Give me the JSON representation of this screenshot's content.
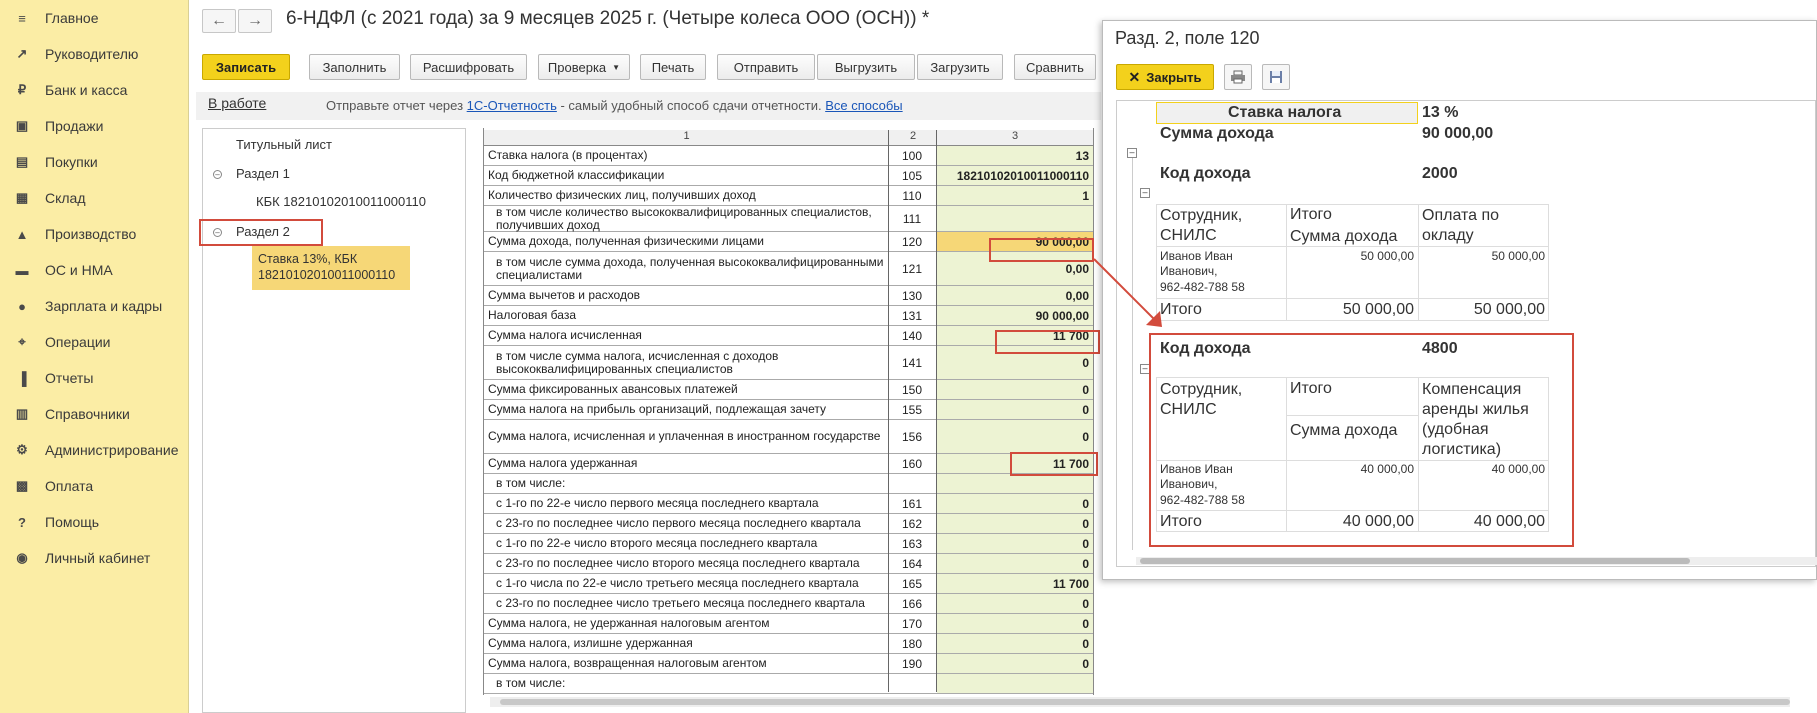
{
  "sidebar": {
    "items": [
      {
        "label": "Главное",
        "icon": "menu-icon"
      },
      {
        "label": "Руководителю",
        "icon": "chart-line-icon"
      },
      {
        "label": "Банк и касса",
        "icon": "coin-icon"
      },
      {
        "label": "Продажи",
        "icon": "bag-icon"
      },
      {
        "label": "Покупки",
        "icon": "cart-icon"
      },
      {
        "label": "Склад",
        "icon": "warehouse-icon"
      },
      {
        "label": "Производство",
        "icon": "factory-icon"
      },
      {
        "label": "ОС и НМА",
        "icon": "truck-icon"
      },
      {
        "label": "Зарплата и кадры",
        "icon": "person-icon"
      },
      {
        "label": "Операции",
        "icon": "operations-icon"
      },
      {
        "label": "Отчеты",
        "icon": "bar-chart-icon"
      },
      {
        "label": "Справочники",
        "icon": "book-icon"
      },
      {
        "label": "Администрирование",
        "icon": "gear-icon"
      },
      {
        "label": "Оплата",
        "icon": "payment-icon"
      },
      {
        "label": "Помощь",
        "icon": "question-icon"
      },
      {
        "label": "Личный кабинет",
        "icon": "account-icon"
      }
    ]
  },
  "header": {
    "title": "6-НДФЛ (с 2021 года) за 9 месяцев 2025 г. (Четыре колеса ООО (ОСН)) *",
    "back_icon": "arrow-left-icon",
    "forward_icon": "arrow-right-icon"
  },
  "toolbar": {
    "save": "Записать",
    "fill": "Заполнить",
    "decode": "Расшифровать",
    "check": "Проверка",
    "print": "Печать",
    "send": "Отправить",
    "upload": "Выгрузить",
    "download": "Загрузить",
    "compare": "Сравнить"
  },
  "infobar": {
    "status": "В работе",
    "text_before": "Отправьте отчет через ",
    "link1": "1С-Отчетность",
    "text_middle": " - самый удобный способ сдачи отчетности. ",
    "link2": "Все способы"
  },
  "tree": {
    "title_sheet": "Титульный лист",
    "section1": "Раздел 1",
    "kbk": "КБК 18210102010011000110",
    "section2": "Раздел 2",
    "selected_line1": "Ставка 13%, КБК",
    "selected_line2": "18210102010011000110"
  },
  "table": {
    "headers": [
      "1",
      "2",
      "3"
    ],
    "rows": [
      {
        "label": "Ставка налога (в процентах)",
        "code": "100",
        "value": "13"
      },
      {
        "label": "Код бюджетной классификации",
        "code": "105",
        "value": "18210102010011000110"
      },
      {
        "label": "Количество физических лиц, получивших доход",
        "code": "110",
        "value": "1"
      },
      {
        "label": "в том числе количество высококвалифицированных специалистов, получивших доход",
        "code": "111",
        "value": ""
      },
      {
        "label": "Сумма дохода, полученная физическими лицами",
        "code": "120",
        "value": "90 000,00"
      },
      {
        "label": "в том числе сумма дохода, полученная высококвалифицированными специалистами",
        "code": "121",
        "value": "0,00"
      },
      {
        "label": "Сумма вычетов и расходов",
        "code": "130",
        "value": "0,00"
      },
      {
        "label": "Налоговая база",
        "code": "131",
        "value": "90 000,00"
      },
      {
        "label": "Сумма налога исчисленная",
        "code": "140",
        "value": "11 700"
      },
      {
        "label": "в том числе сумма налога, исчисленная с доходов высококвалифицированных специалистов",
        "code": "141",
        "value": "0"
      },
      {
        "label": "Сумма фиксированных авансовых платежей",
        "code": "150",
        "value": "0"
      },
      {
        "label": "Сумма налога на прибыль организаций, подлежащая зачету",
        "code": "155",
        "value": "0"
      },
      {
        "label": "Сумма налога, исчисленная и уплаченная в иностранном государстве",
        "code": "156",
        "value": "0"
      },
      {
        "label": "Сумма налога удержанная",
        "code": "160",
        "value": "11 700"
      },
      {
        "label": "в том числе:",
        "code": "",
        "value": ""
      },
      {
        "label": "с 1-го по 22-е число первого месяца последнего квартала",
        "code": "161",
        "value": "0"
      },
      {
        "label": "с 23-го по последнее число первого месяца последнего квартала",
        "code": "162",
        "value": "0"
      },
      {
        "label": "с 1-го по 22-е число второго месяца последнего квартала",
        "code": "163",
        "value": "0"
      },
      {
        "label": "с 23-го по последнее число второго месяца последнего квартала",
        "code": "164",
        "value": "0"
      },
      {
        "label": "с 1-го числа по 22-е число третьего месяца последнего квартала",
        "code": "165",
        "value": "11 700"
      },
      {
        "label": "с 23-го по последнее число третьего месяца последнего квартала",
        "code": "166",
        "value": "0"
      },
      {
        "label": "Сумма налога, не удержанная налоговым агентом",
        "code": "170",
        "value": "0"
      },
      {
        "label": "Сумма налога, излишне удержанная",
        "code": "180",
        "value": "0"
      },
      {
        "label": "Сумма налога, возвращенная налоговым агентом",
        "code": "190",
        "value": "0"
      },
      {
        "label": "в том числе:",
        "code": "",
        "value": ""
      }
    ]
  },
  "popup": {
    "title": "Разд. 2, поле 120",
    "close": "Закрыть",
    "print_icon": "printer-icon",
    "save_icon": "floppy-icon",
    "rate_label": "Ставка налога",
    "rate_value": "13 %",
    "income_sum_label": "Сумма дохода",
    "income_sum_value": "90 000,00",
    "block1": {
      "code_label": "Код дохода",
      "code_value": "2000",
      "col1": "Сотрудник, СНИЛС",
      "col2_top": "Итого",
      "col2_bottom": "Сумма дохода",
      "col3": "Оплата по окладу",
      "employee": "Иванов Иван Иванович,",
      "snils": "962-482-788 58",
      "emp_total": "50 000,00",
      "emp_col3": "50 000,00",
      "total_label": "Итого",
      "total_sum": "50 000,00",
      "total_col3": "50 000,00"
    },
    "block2": {
      "code_label": "Код дохода",
      "code_value": "4800",
      "col1": "Сотрудник, СНИЛС",
      "col2_top": "Итого",
      "col2_bottom": "Сумма дохода",
      "col3": "Компенсация аренды жилья (удобная логистика)",
      "employee": "Иванов Иван Иванович,",
      "snils": "962-482-788 58",
      "emp_total": "40 000,00",
      "emp_col3": "40 000,00",
      "total_label": "Итого",
      "total_sum": "40 000,00",
      "total_col3": "40 000,00"
    }
  },
  "colors": {
    "sidebar_bg": "#fbeda5",
    "accent_yellow": "#f3d11c",
    "highlight_red": "#d24b3c",
    "cell_green": "#edf3d3"
  }
}
